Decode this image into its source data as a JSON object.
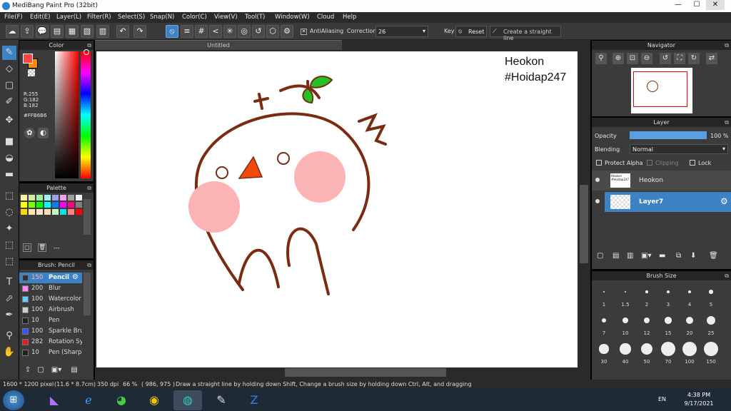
{
  "window": {
    "title": "MediBang Paint Pro (32bit)",
    "minimize": "—",
    "maximize": "☐",
    "close": "✕"
  },
  "menu": [
    "File(F)",
    "Edit(E)",
    "Layer(L)",
    "Filter(R)",
    "Select(S)",
    "Snap(N)",
    "Color(C)",
    "View(V)",
    "Tool(T)",
    "Window(W)",
    "Cloud",
    "Help"
  ],
  "toolbar": {
    "antialiasing_label": "AntiAliasing",
    "correction_label": "Correction",
    "correction_value": "26",
    "key_label": "Key",
    "reset_label": "Reset",
    "straight_line_label": "Create a straight line"
  },
  "color_panel": {
    "title": "Color",
    "r": "R:255",
    "g": "G:182",
    "b": "B:182",
    "hex": "#FFB6B6",
    "fg": "#ff4444",
    "bg": "#ff8a00"
  },
  "palette_panel": {
    "title": "Palette",
    "footer": "---",
    "colors": [
      "#f5f5a0",
      "#cdf0a0",
      "#a0f0a0",
      "#a0f0f0",
      "#a0a0f0",
      "#f0a0f0",
      "#a0a0a0",
      "#f0f0f0",
      "#ffff00",
      "#80ff00",
      "#00ff00",
      "#00ffff",
      "#0080ff",
      "#ff00ff",
      "#ff0080",
      "#808080",
      "#ffd700",
      "#ffe4b5",
      "#ffe4c4",
      "#f5deb3",
      "#c0ffc0",
      "#00e5e5",
      "#ff8080",
      "#ff0000"
    ]
  },
  "brush_panel": {
    "title": "Brush: Pencil",
    "brushes": [
      {
        "size": "150",
        "name": "Pencil",
        "color": "#333333",
        "selected": true
      },
      {
        "size": "200",
        "name": "Blur",
        "color": "#ff88ff",
        "selected": false
      },
      {
        "size": "100",
        "name": "Watercolor",
        "color": "#5bd0ff",
        "selected": false
      },
      {
        "size": "100",
        "name": "Airbrush",
        "color": "#cfcfcf",
        "selected": false
      },
      {
        "size": "10",
        "name": "Pen",
        "color": "#222222",
        "selected": false
      },
      {
        "size": "100",
        "name": "Sparkle Bru",
        "color": "#3355ff",
        "selected": false
      },
      {
        "size": "282",
        "name": "Rotation Sy",
        "color": "#e02020",
        "selected": false
      },
      {
        "size": "10",
        "name": "Pen (Sharp",
        "color": "#222222",
        "selected": false
      }
    ]
  },
  "canvas": {
    "tab_title": "Untitled",
    "text_line1": "Heokon",
    "text_line2": "#Hoidap247"
  },
  "navigator": {
    "title": "Navigator"
  },
  "layer_panel": {
    "title": "Layer",
    "opacity_label": "Opacity",
    "opacity_value": "100 %",
    "opacity": 1.0,
    "blending_label": "Blending",
    "blending_value": "Normal",
    "protect_alpha_label": "Protect Alpha",
    "clipping_label": "Clipping",
    "lock_label": "Lock",
    "layers": [
      {
        "name": "Heokon",
        "thumb": "Heokon\n#Hoidap247",
        "selected": false
      },
      {
        "name": "Layer7",
        "thumb": "",
        "selected": true
      }
    ]
  },
  "brush_size_panel": {
    "title": "Brush Size",
    "sizes": [
      "1",
      "1.5",
      "2",
      "3",
      "4",
      "5",
      "7",
      "10",
      "12",
      "15",
      "20",
      "25",
      "30",
      "40",
      "50",
      "70",
      "100",
      "150"
    ]
  },
  "status": {
    "pixels": "1600 * 1200 pixel",
    "cm": "(11.6 * 8.7cm)",
    "dpi": "350 dpi",
    "zoom": "66 %",
    "coords": "( 986, 975 )",
    "hint": "Draw a straight line by holding down Shift, Change a brush size by holding down Ctrl, Alt, and dragging"
  },
  "taskbar": {
    "lang": "EN",
    "time": "4:38 PM",
    "date": "9/17/2021"
  }
}
